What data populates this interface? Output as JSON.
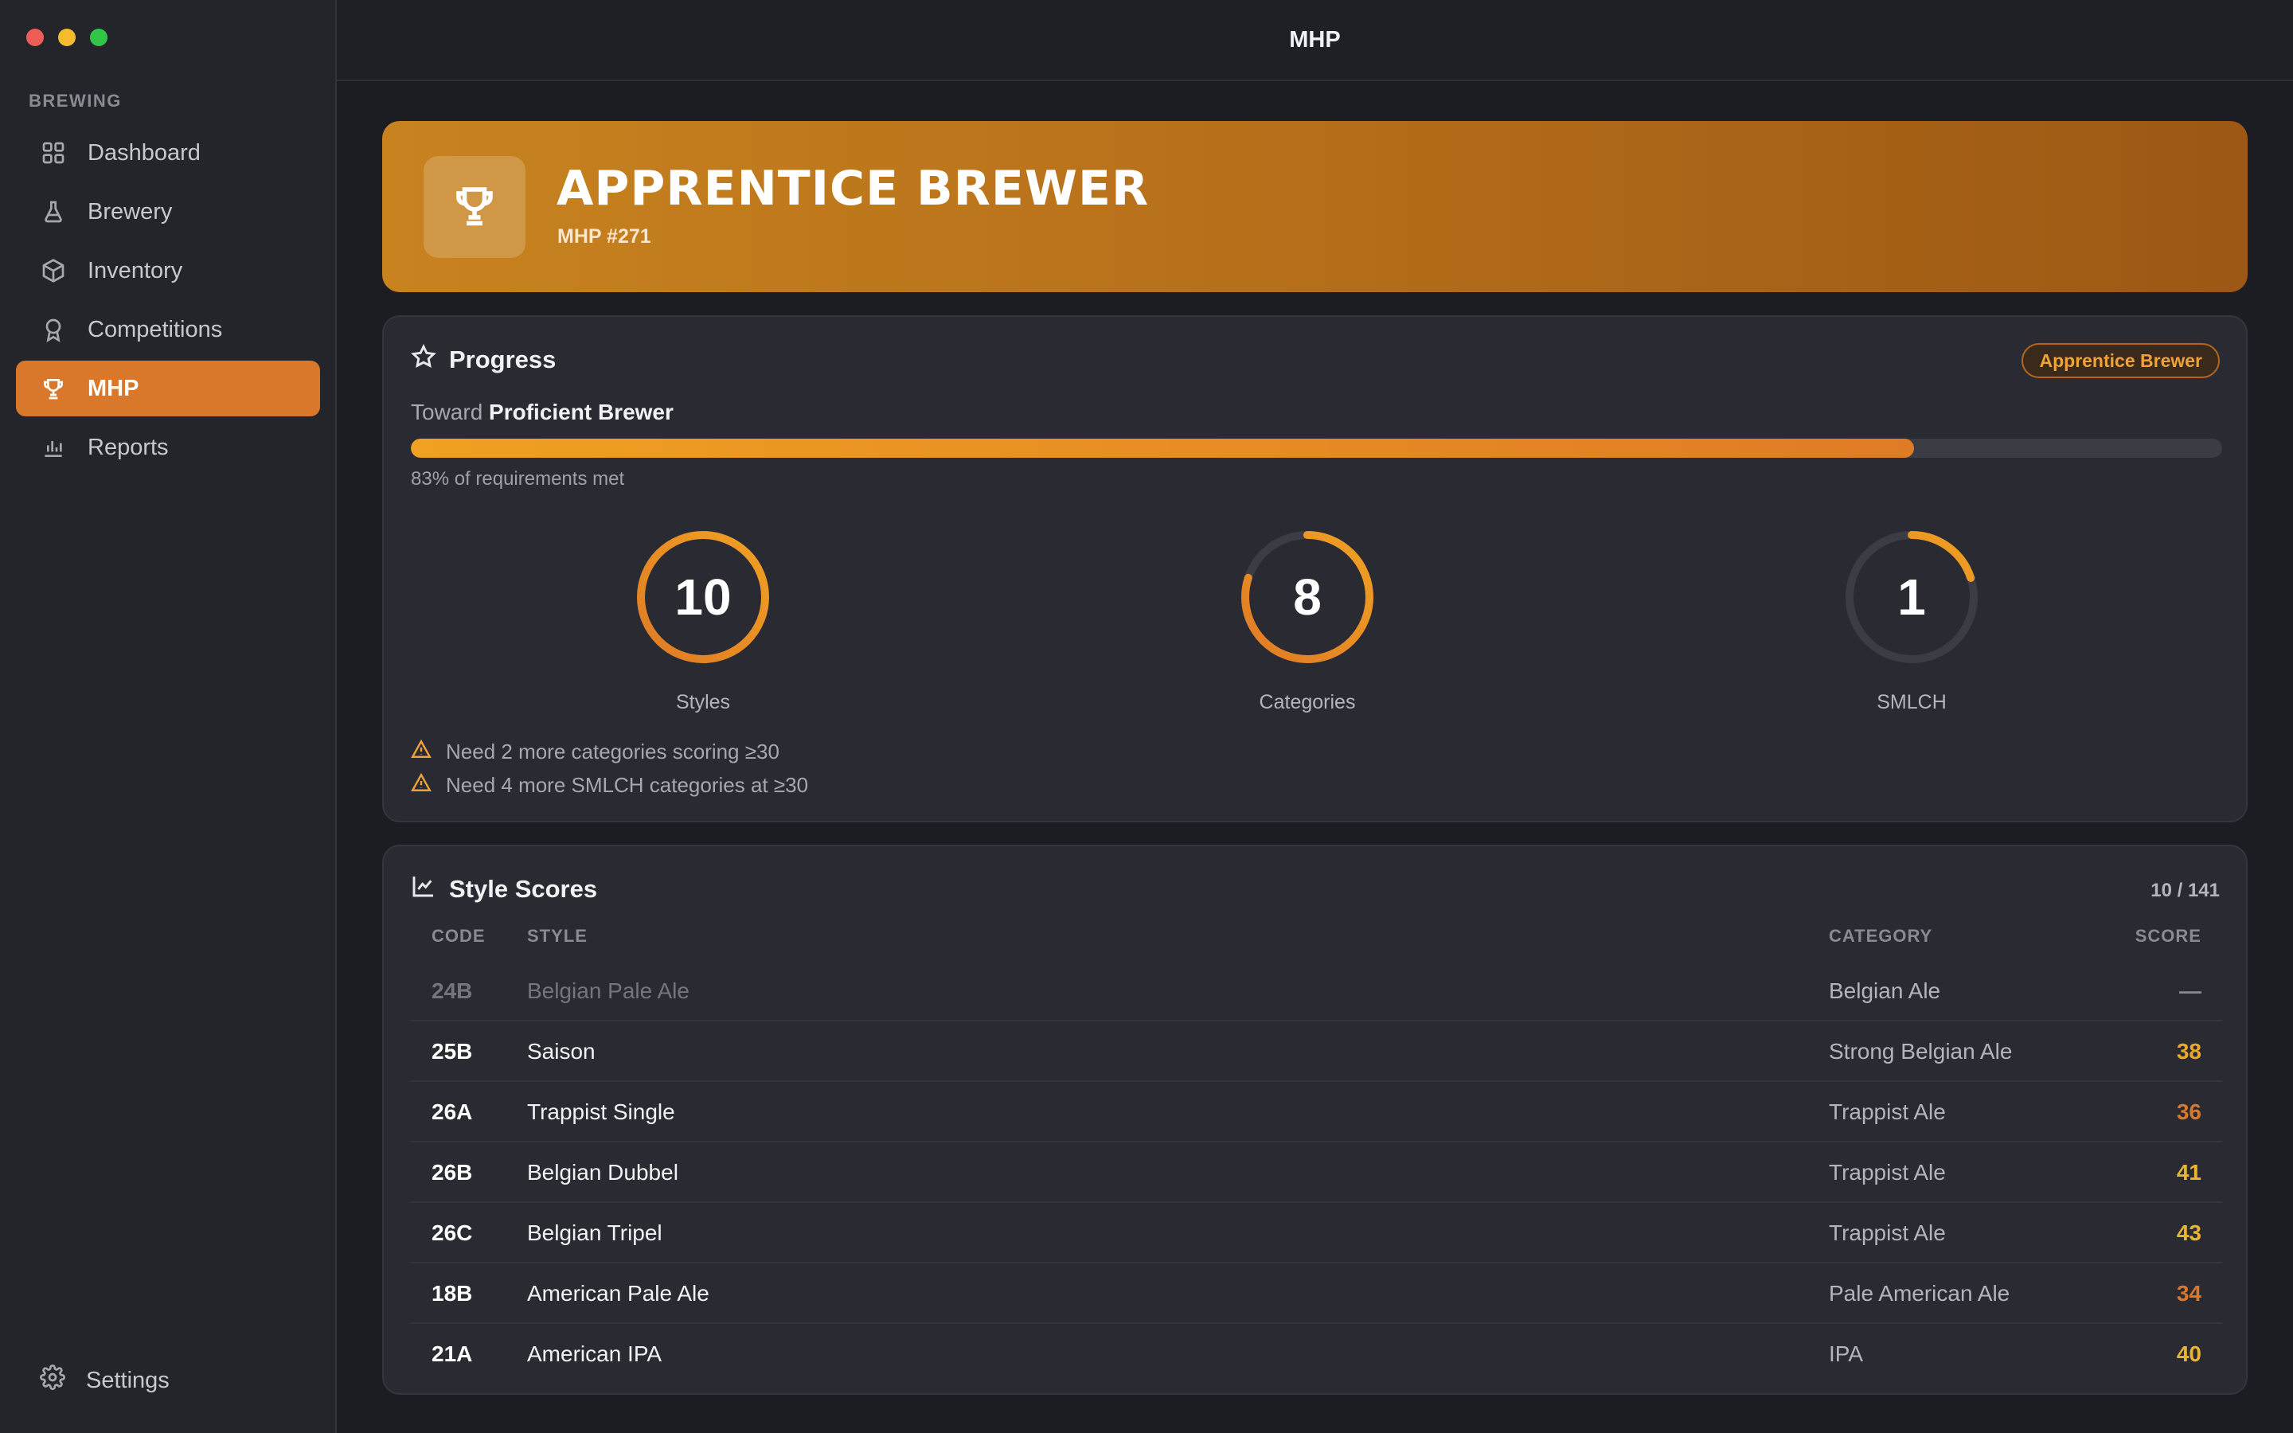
{
  "window": {
    "title": "MHP",
    "traffic_lights": [
      "#ee5d56",
      "#f4bb2f",
      "#32c649"
    ]
  },
  "sidebar": {
    "section_label": "BREWING",
    "items": [
      {
        "label": "Dashboard",
        "icon": "grid-icon"
      },
      {
        "label": "Brewery",
        "icon": "flask-icon"
      },
      {
        "label": "Inventory",
        "icon": "box-icon"
      },
      {
        "label": "Competitions",
        "icon": "ribbon-icon"
      },
      {
        "label": "MHP",
        "icon": "trophy-icon",
        "active": true
      },
      {
        "label": "Reports",
        "icon": "bar-chart-icon"
      }
    ],
    "settings_label": "Settings"
  },
  "hero": {
    "title": "APPRENTICE BREWER",
    "subtitle": "MHP #271",
    "icon": "trophy-icon",
    "gradient": [
      "#c8831f",
      "#9c5814"
    ]
  },
  "progress": {
    "title": "Progress",
    "badge": "Apprentice Brewer",
    "toward_prefix": "Toward",
    "toward_target": "Proficient Brewer",
    "percent": 83,
    "caption": "83% of requirements met",
    "rings": [
      {
        "value": "10",
        "label": "Styles",
        "fraction": 1.0
      },
      {
        "value": "8",
        "label": "Categories",
        "fraction": 0.8
      },
      {
        "value": "1",
        "label": "SMLCH",
        "fraction": 0.2
      }
    ],
    "warnings": [
      "Need 2 more categories scoring ≥30",
      "Need 4 more SMLCH categories at ≥30"
    ]
  },
  "scores": {
    "title": "Style Scores",
    "count": "10 / 141",
    "columns": {
      "code": "CODE",
      "style": "STYLE",
      "category": "CATEGORY",
      "score": "SCORE"
    },
    "rows": [
      {
        "code": "24B",
        "style": "Belgian Pale Ale",
        "category": "Belgian Ale",
        "score": "—",
        "color": "#8a8b92",
        "dim": true
      },
      {
        "code": "25B",
        "style": "Saison",
        "category": "Strong Belgian Ale",
        "score": "38",
        "color": "#e9a92b"
      },
      {
        "code": "26A",
        "style": "Trappist Single",
        "category": "Trappist Ale",
        "score": "36",
        "color": "#d9782a"
      },
      {
        "code": "26B",
        "style": "Belgian Dubbel",
        "category": "Trappist Ale",
        "score": "41",
        "color": "#e9b52b"
      },
      {
        "code": "26C",
        "style": "Belgian Tripel",
        "category": "Trappist Ale",
        "score": "43",
        "color": "#e9b52b"
      },
      {
        "code": "18B",
        "style": "American Pale Ale",
        "category": "Pale American Ale",
        "score": "34",
        "color": "#d9782a"
      },
      {
        "code": "21A",
        "style": "American IPA",
        "category": "IPA",
        "score": "40",
        "color": "#e9b52b"
      }
    ]
  },
  "colors": {
    "accent": "#d9782a",
    "ring_track": "#3b3c44",
    "ring_start": "#f0a023",
    "ring_end": "#e07b25"
  }
}
